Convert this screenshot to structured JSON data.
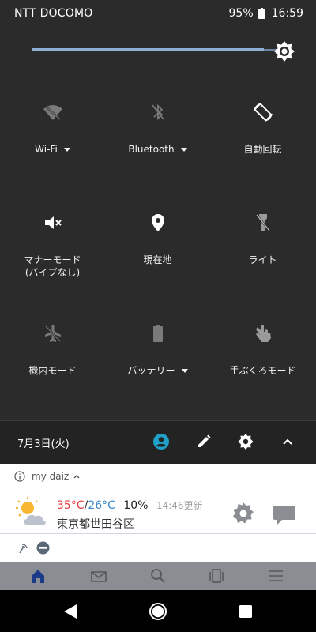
{
  "status": {
    "carrier": "NTT DOCOMO",
    "battery": "95%",
    "time": "16:59",
    "icons": [
      "battery-icon"
    ]
  },
  "brightness": {
    "level": 0.92,
    "icon": "brightness-icon"
  },
  "tiles": [
    {
      "label": "Wi-Fi",
      "icon": "wifi-off-icon",
      "has_dropdown": true
    },
    {
      "label": "Bluetooth",
      "icon": "bluetooth-off-icon",
      "has_dropdown": true
    },
    {
      "label": "自動回転",
      "icon": "auto-rotate-icon",
      "has_dropdown": false
    },
    {
      "label": "マナーモード",
      "label2": "(バイブなし)",
      "icon": "mute-icon",
      "has_dropdown": false
    },
    {
      "label": "現在地",
      "icon": "location-icon",
      "has_dropdown": false
    },
    {
      "label": "ライト",
      "icon": "flashlight-icon",
      "has_dropdown": false
    },
    {
      "label": "機内モード",
      "icon": "airplane-off-icon",
      "has_dropdown": false
    },
    {
      "label": "バッテリー",
      "icon": "battery-saver-icon",
      "has_dropdown": true
    },
    {
      "label": "手ぶくろモード",
      "icon": "glove-mode-icon",
      "has_dropdown": false
    }
  ],
  "date_row": {
    "date": "7月3日(火)",
    "icons": [
      "user-icon",
      "edit-icon",
      "settings-icon",
      "collapse-icon"
    ],
    "accent": "#1ea0c8"
  },
  "notification": {
    "app_name": "my daiz",
    "temp_high": "35°C",
    "temp_sep": "/",
    "temp_low": "26°C",
    "rain_chance": "10%",
    "updated": "14:46更新",
    "location": "東京都世田谷区",
    "icons": [
      "info-icon",
      "chevron-up-icon",
      "weather-sunny-cloudy-icon",
      "gear-icon",
      "chat-icon"
    ],
    "colors": {
      "high": "#e33d3d",
      "low": "#3a86c8"
    }
  },
  "notification2": {
    "icons": [
      "antenna-icon",
      "do-not-disturb-icon"
    ]
  },
  "app_tabbar": {
    "icons": [
      "home-icon",
      "mail-icon",
      "search-icon",
      "pages-icon",
      "menu-icon"
    ]
  },
  "navbar": {
    "icons": [
      "back-icon",
      "home-button-icon",
      "recents-icon"
    ]
  }
}
